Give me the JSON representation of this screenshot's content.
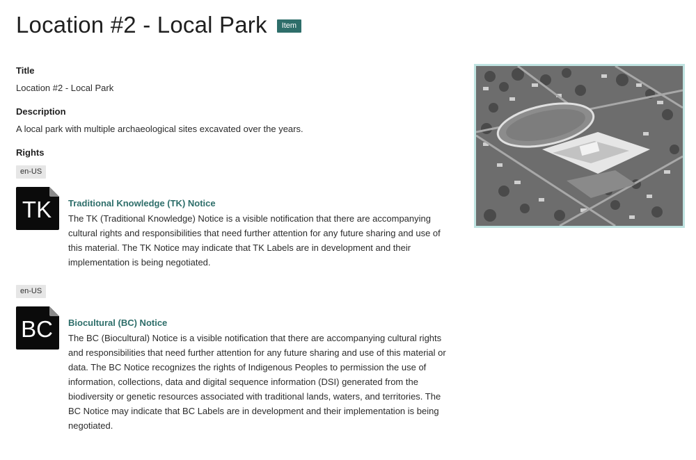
{
  "page": {
    "title": "Location #2 - Local Park",
    "badge": "Item"
  },
  "fields": {
    "title_label": "Title",
    "title_value": "Location #2 - Local Park",
    "description_label": "Description",
    "description_value": "A local park with multiple archaeological sites excavated over the years.",
    "rights_label": "Rights"
  },
  "notices": [
    {
      "lang": "en-US",
      "icon_text": "TK",
      "icon_name": "tk-notice-icon",
      "title": "Traditional Knowledge (TK) Notice",
      "text": "The TK (Traditional Knowledge) Notice is a visible notification that there are accompanying cultural rights and responsibilities that need further attention for any future sharing and use of this material. The TK Notice may indicate that TK Labels are in development and their implementation is being negotiated."
    },
    {
      "lang": "en-US",
      "icon_text": "BC",
      "icon_name": "bc-notice-icon",
      "title": "Biocultural (BC) Notice",
      "text": "The BC (Biocultural) Notice is a visible notification that there are accompanying cultural rights and responsibilities that need further attention for any future sharing and use of this material or data. The BC Notice recognizes the rights of Indigenous Peoples to permission the use of information, collections, data and digital sequence information (DSI) generated from the biodiversity or genetic resources associated with traditional lands, waters, and territories. The BC Notice may indicate that BC Labels are in development and their implementation is being negotiated."
    }
  ],
  "colors": {
    "accent": "#2e6e6a",
    "photo_border": "#bfe3e1",
    "tag_bg": "#e6e6e6"
  }
}
